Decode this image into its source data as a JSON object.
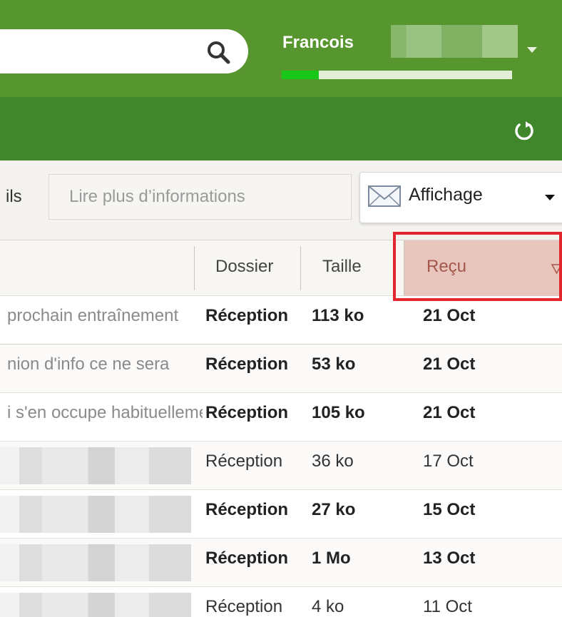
{
  "header": {
    "user_name": "Francois",
    "quota_used_fraction": 0.16,
    "colors": {
      "header_bg": "#57952f",
      "subbar_bg": "#40862a",
      "quota_fill": "#18c818"
    }
  },
  "toolbar": {
    "fragment_label": "ils",
    "more_info_label": "Lire plus d’informations",
    "view_label": "Affichage"
  },
  "columns": {
    "folder": "Dossier",
    "size": "Taille",
    "date": "Reçu"
  },
  "highlight_color": "#e3252e",
  "rows": [
    {
      "subject": "prochain entraînement",
      "folder": "Réception",
      "size": "113 ko",
      "date": "21 Oct",
      "unread": true
    },
    {
      "subject": "nion d'info ce ne sera",
      "folder": "Réception",
      "size": "53 ko",
      "date": "21 Oct",
      "unread": true
    },
    {
      "subject": "i s'en occupe habituellement",
      "folder": "Réception",
      "size": "105 ko",
      "date": "21 Oct",
      "unread": true
    },
    {
      "subject": "",
      "folder": "Réception",
      "size": "36 ko",
      "date": "17 Oct",
      "unread": false
    },
    {
      "subject": "",
      "folder": "Réception",
      "size": "27 ko",
      "date": "15 Oct",
      "unread": true
    },
    {
      "subject": "",
      "folder": "Réception",
      "size": "1 Mo",
      "date": "13 Oct",
      "unread": true
    },
    {
      "subject": "",
      "folder": "Réception",
      "size": "4 ko",
      "date": "11 Oct",
      "unread": false
    }
  ]
}
